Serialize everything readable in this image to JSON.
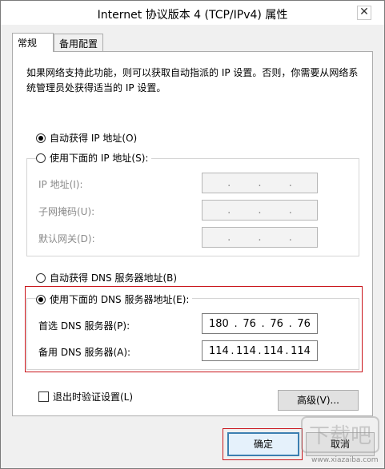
{
  "window": {
    "title": "Internet 协议版本 4 (TCP/IPv4) 属性",
    "close_glyph": "✕"
  },
  "tabs": [
    {
      "label": "常规",
      "active": true
    },
    {
      "label": "备用配置",
      "active": false
    }
  ],
  "description": "如果网络支持此功能，则可以获取自动指派的 IP 设置。否则，你需要从网络系统管理员处获得适当的 IP 设置。",
  "ip_section": {
    "auto_label": "自动获得 IP 地址(O)",
    "manual_label": "使用下面的 IP 地址(S):",
    "selected": "auto",
    "fields": [
      {
        "label": "IP 地址(I):",
        "segments": [
          ".",
          ".",
          "."
        ]
      },
      {
        "label": "子网掩码(U):",
        "segments": [
          ".",
          ".",
          "."
        ]
      },
      {
        "label": "默认网关(D):",
        "segments": [
          ".",
          ".",
          "."
        ]
      }
    ]
  },
  "dns_section": {
    "auto_label": "自动获得 DNS 服务器地址(B)",
    "manual_label": "使用下面的 DNS 服务器地址(E):",
    "selected": "manual",
    "preferred": {
      "label": "首选 DNS 服务器(P):",
      "octets": [
        "180",
        "76",
        "76",
        "76"
      ]
    },
    "alternate": {
      "label": "备用 DNS 服务器(A):",
      "octets": [
        "114",
        "114",
        "114",
        "114"
      ]
    }
  },
  "validate_label": "退出时验证设置(L)",
  "buttons": {
    "advanced": "高级(V)...",
    "ok": "确定",
    "cancel": "取消"
  },
  "watermark": {
    "text": "下载吧",
    "url_text": "www.xiazaiba.com"
  },
  "colors": {
    "highlight": "#c9151b",
    "focus": "#3c7fb1"
  }
}
